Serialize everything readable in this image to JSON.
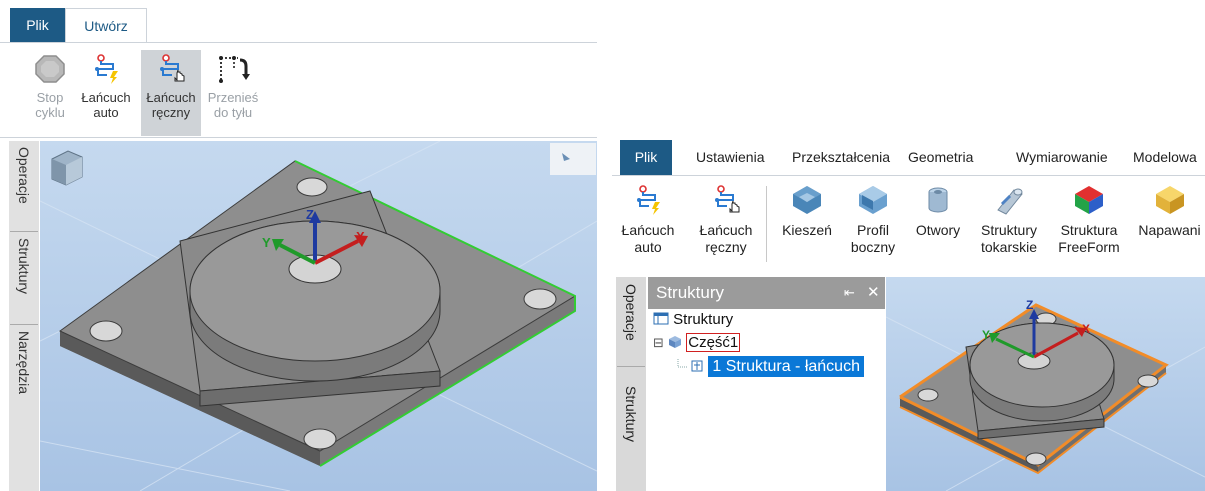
{
  "left_window": {
    "tabs": [
      {
        "label": "Plik",
        "active": false
      },
      {
        "label": "Utwórz",
        "active": true
      }
    ],
    "ribbon": {
      "buttons": [
        {
          "line1": "Stop",
          "line2": "cyklu",
          "icon": "stop-octagon-icon",
          "state": "disabled"
        },
        {
          "line1": "Łańcuch",
          "line2": "auto",
          "icon": "chain-auto-icon",
          "state": "normal"
        },
        {
          "line1": "Łańcuch",
          "line2": "ręczny",
          "icon": "chain-manual-icon",
          "state": "active"
        },
        {
          "line1": "Przenieś",
          "line2": "do tyłu",
          "icon": "move-back-icon",
          "state": "disabled"
        }
      ]
    },
    "side_tabs": [
      "Operacje",
      "Struktury",
      "Narzędzia"
    ],
    "viewport": {
      "axes": [
        "X",
        "Y",
        "Z"
      ],
      "highlight_color": "#33cc33"
    }
  },
  "right_window": {
    "tabs": [
      "Plik",
      "Ustawienia",
      "Przekształcenia",
      "Geometria",
      "Wymiarowanie",
      "Modelowa"
    ],
    "ribbon": {
      "buttons": [
        {
          "line1": "Łańcuch",
          "line2": "auto",
          "icon": "chain-auto-icon"
        },
        {
          "line1": "Łańcuch",
          "line2": "ręczny",
          "icon": "chain-manual-icon"
        },
        {
          "line1": "Kieszeń",
          "line2": "",
          "icon": "pocket-icon"
        },
        {
          "line1": "Profil",
          "line2": "boczny",
          "icon": "side-profile-icon"
        },
        {
          "line1": "Otwory",
          "line2": "",
          "icon": "holes-icon"
        },
        {
          "line1": "Struktury",
          "line2": "tokarskie",
          "icon": "turning-features-icon"
        },
        {
          "line1": "Struktura",
          "line2": "FreeForm",
          "icon": "freeform-icon"
        },
        {
          "line1": "Napawani",
          "line2": "",
          "icon": "deposition-icon"
        }
      ]
    },
    "side_tabs": [
      "Operacje",
      "Struktury"
    ],
    "structures_panel": {
      "title": "Struktury",
      "pin": "⇤",
      "close": "✕",
      "tree": [
        {
          "label": "Struktury",
          "level": 0,
          "expander": "",
          "selected": false,
          "boxed": false
        },
        {
          "label": "Część1",
          "level": 1,
          "expander": "⊟",
          "selected": false,
          "boxed": true
        },
        {
          "label": "1 Struktura - łańcuch",
          "level": 2,
          "expander": "",
          "selected": true,
          "boxed": false
        }
      ]
    },
    "viewport": {
      "axes": [
        "X",
        "Y",
        "Z"
      ],
      "highlight_color": "#f28c28"
    }
  },
  "colors": {
    "brand_blue": "#1d5a85",
    "viewport_bg": "#b8cfe8",
    "selection": "#0a78d7"
  }
}
